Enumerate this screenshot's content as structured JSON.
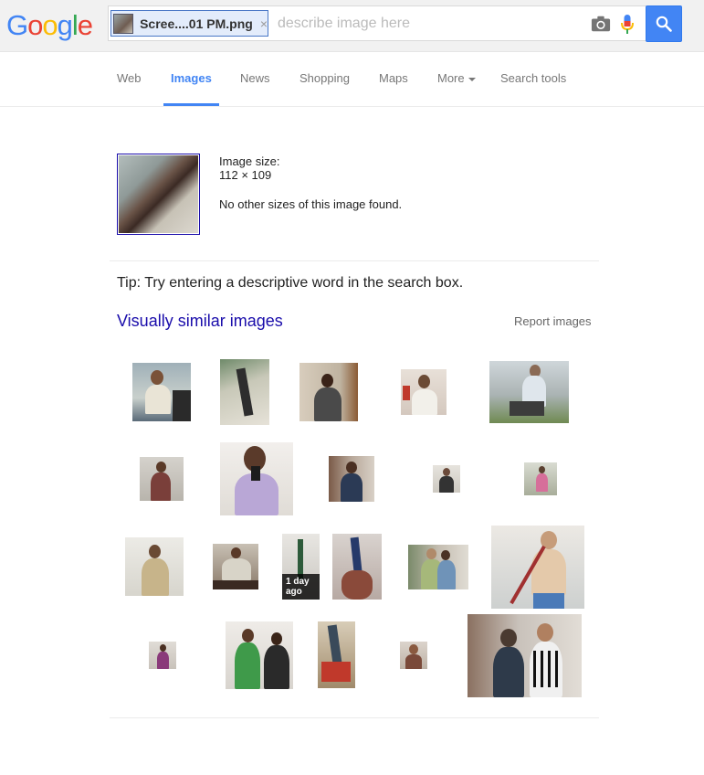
{
  "header": {
    "logo_letters": [
      {
        "char": "G",
        "color": "#4285f4"
      },
      {
        "char": "o",
        "color": "#ea4335"
      },
      {
        "char": "o",
        "color": "#fbbc05"
      },
      {
        "char": "g",
        "color": "#4285f4"
      },
      {
        "char": "l",
        "color": "#34a853"
      },
      {
        "char": "e",
        "color": "#ea4335"
      }
    ],
    "chip_filename": "Scree....01 PM.png",
    "chip_close": "×",
    "search_placeholder": "describe image here",
    "search_value": ""
  },
  "tabs": [
    {
      "label": "Web"
    },
    {
      "label": "Images",
      "active": true
    },
    {
      "label": "News"
    },
    {
      "label": "Shopping"
    },
    {
      "label": "Maps"
    },
    {
      "label": "More"
    },
    {
      "label": "Search tools"
    }
  ],
  "query_image": {
    "size_label": "Image size:",
    "size_value": "112 × 109",
    "no_other_sizes": "No other sizes of this image found."
  },
  "tip": "Tip: Try entering a descriptive word in the search box.",
  "similar": {
    "title": "Visually similar images",
    "report": "Report images",
    "badge_text": "1 day ago"
  },
  "colors": {
    "accent": "#4285f4",
    "link": "#1a0dab"
  }
}
